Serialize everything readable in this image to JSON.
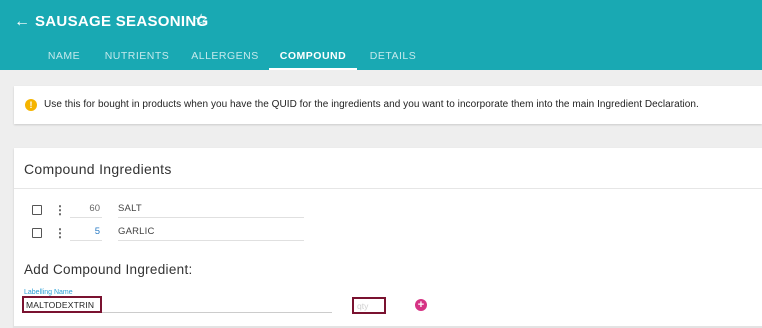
{
  "header": {
    "back_icon": "arrow-left-icon",
    "title": "SAUSAGE SEASONING",
    "star_icon": "star-outline-icon",
    "tabs": [
      {
        "label": "NAME",
        "active": false
      },
      {
        "label": "NUTRIENTS",
        "active": false
      },
      {
        "label": "ALLERGENS",
        "active": false
      },
      {
        "label": "COMPOUND",
        "active": true
      },
      {
        "label": "DETAILS",
        "active": false
      }
    ]
  },
  "info": {
    "icon": "info-icon",
    "text": "Use this for bought in products when you have the QUID for the ingredients and you want to incorporate them into the main Ingredient Declaration."
  },
  "compound": {
    "title": "Compound Ingredients",
    "ingredients": [
      {
        "qty": "60",
        "name": "SALT",
        "checked": false
      },
      {
        "qty": "5",
        "name": "GARLIC",
        "checked": false
      }
    ],
    "add_title": "Add Compound Ingredient:",
    "labelling_name_label": "Labelling Name",
    "labelling_name_value": "MALTODEXTRIN",
    "qty_placeholder": "qty",
    "add_icon": "plus-circle-icon"
  },
  "colors": {
    "header_bg": "#19a9b3",
    "info_icon": "#f5b400",
    "highlight_border": "#7a1230",
    "add_button": "#d63384",
    "label_blue": "#2a9fd6"
  }
}
